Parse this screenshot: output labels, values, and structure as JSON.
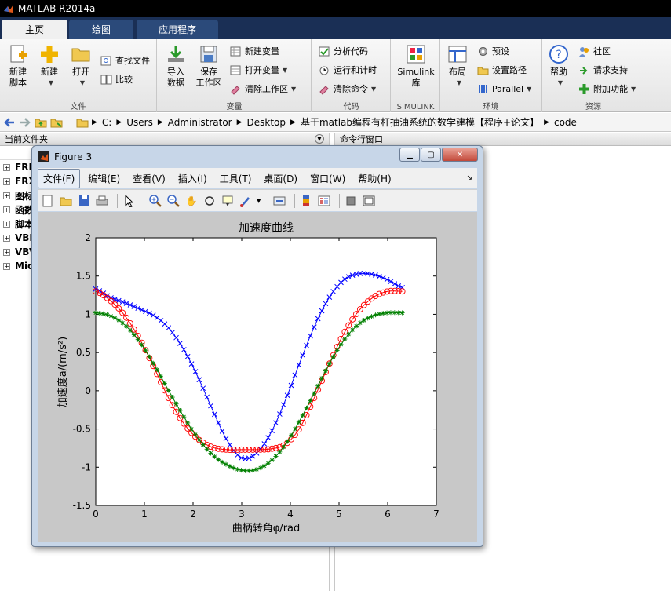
{
  "app": {
    "title": "MATLAB R2014a"
  },
  "tabs": [
    {
      "label": "主页"
    },
    {
      "label": "绘图"
    },
    {
      "label": "应用程序"
    }
  ],
  "ribbon": {
    "file": {
      "label": "文件",
      "new_script": "新建\n脚本",
      "new": "新建",
      "open": "打开",
      "find_files": "查找文件",
      "compare": "比较"
    },
    "variable": {
      "label": "变量",
      "import_data": "导入\n数据",
      "save_workspace": "保存\n工作区",
      "new_variable": "新建变量",
      "open_variable": "打开变量",
      "clear_workspace": "清除工作区"
    },
    "code": {
      "label": "代码",
      "analyze": "分析代码",
      "run_time": "运行和计时",
      "clear_commands": "清除命令"
    },
    "simulink": {
      "label": "SIMULINK",
      "library": "Simulink\n库"
    },
    "environment": {
      "label": "环境",
      "layout": "布局",
      "preferences": "预设",
      "set_path": "设置路径",
      "parallel": "Parallel"
    },
    "resources": {
      "label": "资源",
      "help": "帮助",
      "community": "社区",
      "request_support": "请求支持",
      "addons": "附加功能"
    }
  },
  "address": {
    "crumbs": [
      "C:",
      "Users",
      "Administrator",
      "Desktop",
      "基于matlab编程有杆抽油系统的数学建模【程序+论文】",
      "code"
    ]
  },
  "left_panel": {
    "title": "当前文件夹",
    "items": [
      "FRM",
      "FRX",
      "图标",
      "函数",
      "脚本",
      "VBI",
      "VBV",
      "Mic"
    ]
  },
  "right_panel": {
    "title": "命令行窗口"
  },
  "figure": {
    "title": "Figure 3",
    "menu": [
      "文件(F)",
      "编辑(E)",
      "查看(V)",
      "插入(I)",
      "工具(T)",
      "桌面(D)",
      "窗口(W)",
      "帮助(H)"
    ]
  },
  "chart_data": {
    "type": "line",
    "title": "加速度曲线",
    "xlabel": "曲柄转角φ/rad",
    "ylabel": "加速度a/(m/s²)",
    "xlim": [
      0,
      7
    ],
    "ylim": [
      -1.5,
      2
    ],
    "x_ticks": [
      "0",
      "1",
      "2",
      "3",
      "4",
      "5",
      "6",
      "7"
    ],
    "y_ticks": [
      "-1.5",
      "-1",
      "-0.5",
      "0",
      "0.5",
      "1",
      "1.5",
      "2"
    ],
    "grid": false,
    "legend": "none",
    "series": [
      {
        "color": "#0000ff",
        "marker": "x",
        "x": [
          0,
          0.3,
          0.6,
          0.9,
          1.2,
          1.5,
          1.8,
          2.1,
          2.4,
          2.7,
          3.0,
          3.3,
          3.6,
          3.9,
          4.2,
          4.5,
          4.8,
          5.1,
          5.4,
          5.7,
          6.0,
          6.3
        ],
        "y": [
          1.33,
          1.22,
          1.15,
          1.07,
          0.98,
          0.82,
          0.55,
          0.18,
          -0.25,
          -0.65,
          -0.88,
          -0.82,
          -0.55,
          -0.12,
          0.38,
          0.85,
          1.22,
          1.45,
          1.53,
          1.52,
          1.45,
          1.35
        ]
      },
      {
        "color": "#ff0000",
        "marker": "o",
        "x": [
          0,
          0.3,
          0.6,
          0.9,
          1.2,
          1.5,
          1.8,
          2.1,
          2.4,
          2.7,
          3.0,
          3.3,
          3.6,
          3.9,
          4.2,
          4.5,
          4.8,
          5.1,
          5.4,
          5.7,
          6.0,
          6.3
        ],
        "y": [
          1.3,
          1.18,
          0.98,
          0.68,
          0.3,
          -0.1,
          -0.42,
          -0.63,
          -0.74,
          -0.77,
          -0.77,
          -0.77,
          -0.76,
          -0.7,
          -0.48,
          -0.08,
          0.35,
          0.75,
          1.04,
          1.22,
          1.3,
          1.3
        ]
      },
      {
        "color": "#008000",
        "marker": "*",
        "x": [
          0,
          0.3,
          0.6,
          0.9,
          1.2,
          1.5,
          1.8,
          2.1,
          2.4,
          2.7,
          3.0,
          3.3,
          3.6,
          3.9,
          4.2,
          4.5,
          4.8,
          5.1,
          5.4,
          5.7,
          6.0,
          6.3
        ],
        "y": [
          1.02,
          0.98,
          0.86,
          0.64,
          0.34,
          0.0,
          -0.33,
          -0.62,
          -0.84,
          -0.97,
          -1.04,
          -1.03,
          -0.92,
          -0.7,
          -0.38,
          -0.02,
          0.35,
          0.66,
          0.87,
          0.98,
          1.02,
          1.02
        ]
      }
    ]
  }
}
